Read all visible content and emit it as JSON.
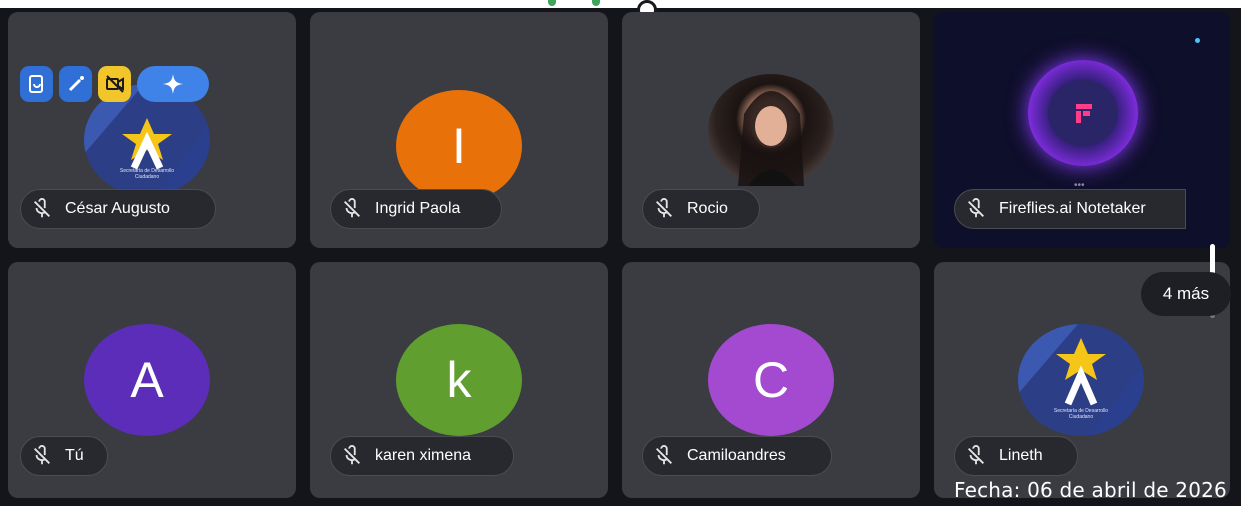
{
  "participants": [
    {
      "name": "César Augusto",
      "type": "logo"
    },
    {
      "name": "Ingrid Paola",
      "initial": "I",
      "color": "#e8710a"
    },
    {
      "name": "Rocio",
      "type": "photo"
    },
    {
      "name": "Fireflies.ai Notetaker",
      "type": "fireflies"
    },
    {
      "name": "Tú",
      "initial": "A",
      "color": "#5b2db8"
    },
    {
      "name": "karen ximena",
      "initial": "k",
      "color": "#5f9e2f"
    },
    {
      "name": "Camiloandres",
      "initial": "C",
      "color": "#a44ad1"
    },
    {
      "name": "Lineth",
      "type": "logo"
    }
  ],
  "overlay_icons": [
    "transcript-icon",
    "magic-wand-icon",
    "no-video-icon",
    "gemini-sparkle-icon"
  ],
  "more_participants": "4 más",
  "date_stamp": "Fecha: 06 de abril de 2026",
  "colors": {
    "tile": "#3a3c42",
    "background": "#13151b",
    "accent_blue": "#2f6fd6",
    "accent_yellow": "#f2c52b"
  }
}
